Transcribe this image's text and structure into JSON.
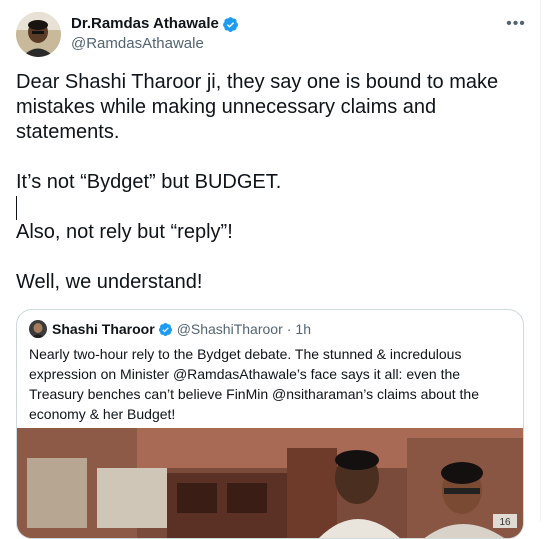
{
  "author": {
    "name": "Dr.Ramdas Athawale",
    "handle": "@RamdasAthawale"
  },
  "more_icon_glyph": "•••",
  "tweet": {
    "paragraphs": [
      "Dear Shashi Tharoor ji, they say one is bound to make mistakes while making unnecessary claims and statements.",
      "It’s not “Bydget” but BUDGET.",
      "Also, not rely but “reply”!",
      "Well, we understand!"
    ]
  },
  "quoted": {
    "name": "Shashi Tharoor",
    "handle": "@ShashiTharoor",
    "separator": "·",
    "time": "1h",
    "text": "Nearly two-hour rely to the Bydget debate. The stunned & incredulous expression on Minister @RamdasAthawale’s face says it all: even the Treasury benches can’t believe FinMin @nsitharaman’s claims about the economy & her Budget!",
    "media_label": "16"
  },
  "colors": {
    "text_primary": "#0f1419",
    "text_secondary": "#536471",
    "verified_blue": "#1d9bf0",
    "border": "#cfd9de"
  },
  "icons": [
    "verified-badge-icon",
    "more-icon"
  ]
}
